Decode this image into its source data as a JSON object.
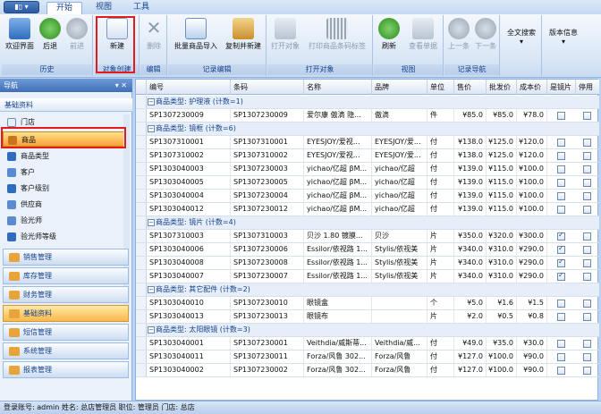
{
  "menu_label": "▮▯ ▾",
  "tabs": [
    "开始",
    "视图",
    "工具"
  ],
  "ribbon": {
    "groups": [
      "历史",
      "对象创建",
      "编辑",
      "记录编辑",
      "打开对象",
      "视图",
      "记录导航",
      "",
      ""
    ],
    "buttons": {
      "welcome": "欢迎界面",
      "back": "后退",
      "forward": "前进",
      "new": "新建",
      "delete": "删除",
      "batch_import": "批量商品导入",
      "copy_new": "复制并新建",
      "open_object": "打开对象",
      "print_barcode": "打印商品条码标签",
      "refresh": "刷新",
      "view_form": "查看单据",
      "prev": "上一条",
      "next": "下一条",
      "full_search": "全文搜索",
      "version_info": "版本信息"
    }
  },
  "nav": {
    "title": "导航",
    "pin": "▾ ✕",
    "category": "基础资料",
    "items": [
      "门店",
      "商品",
      "商品类型",
      "客户",
      "客户级别",
      "供应商",
      "验光师",
      "验光师等级"
    ],
    "categories": [
      "销售管理",
      "库存管理",
      "财务管理",
      "基础资料",
      "短信管理",
      "系统管理",
      "报表管理"
    ]
  },
  "grid": {
    "columns": [
      "编号",
      "条码",
      "名称",
      "品牌",
      "单位",
      "售价",
      "批发价",
      "成本价",
      "是镜片",
      "停用"
    ],
    "groups": [
      {
        "title": "商品类型: 护理液 (计数=1)",
        "rows": [
          {
            "id": "SP1307230009",
            "barcode": "SP1307230009",
            "name": "爱尔康 傲滴 隐...",
            "brand": "傲滴",
            "unit": "件",
            "price": "¥85.0",
            "wholesale": "¥85.0",
            "cost": "¥78.0",
            "lens": false
          }
        ]
      },
      {
        "title": "商品类型: 镜框 (计数=6)",
        "rows": [
          {
            "id": "SP1307310001",
            "barcode": "SP1307310001",
            "name": "EYESJOY/爱视...",
            "brand": "EYESJOY/爱...",
            "unit": "付",
            "price": "¥138.0",
            "wholesale": "¥125.0",
            "cost": "¥120.0",
            "lens": false
          },
          {
            "id": "SP1307310002",
            "barcode": "SP1307310002",
            "name": "EYESJOY/爱视...",
            "brand": "EYESJOY/爱...",
            "unit": "付",
            "price": "¥138.0",
            "wholesale": "¥125.0",
            "cost": "¥120.0",
            "lens": false
          },
          {
            "id": "SP1303040003",
            "barcode": "SP1307230003",
            "name": "yichao/亿超 βM...",
            "brand": "yichao/亿超",
            "unit": "付",
            "price": "¥139.0",
            "wholesale": "¥115.0",
            "cost": "¥100.0",
            "lens": false
          },
          {
            "id": "SP1303040005",
            "barcode": "SP1307230005",
            "name": "yichao/亿超 βM...",
            "brand": "yichao/亿超",
            "unit": "付",
            "price": "¥139.0",
            "wholesale": "¥115.0",
            "cost": "¥100.0",
            "lens": false
          },
          {
            "id": "SP1303040004",
            "barcode": "SP1307230004",
            "name": "yichao/亿超 βM...",
            "brand": "yichao/亿超",
            "unit": "付",
            "price": "¥139.0",
            "wholesale": "¥115.0",
            "cost": "¥100.0",
            "lens": false
          },
          {
            "id": "SP1303040012",
            "barcode": "SP1307230012",
            "name": "yichao/亿超 βM...",
            "brand": "yichao/亿超",
            "unit": "付",
            "price": "¥139.0",
            "wholesale": "¥115.0",
            "cost": "¥100.0",
            "lens": false
          }
        ]
      },
      {
        "title": "商品类型: 镜片 (计数=4)",
        "rows": [
          {
            "id": "SP1307310003",
            "barcode": "SP1307310003",
            "name": "贝沙 1.80 镀膜...",
            "brand": "贝沙",
            "unit": "片",
            "price": "¥350.0",
            "wholesale": "¥320.0",
            "cost": "¥300.0",
            "lens": true
          },
          {
            "id": "SP1303040006",
            "barcode": "SP1307230006",
            "name": "Essilor/依视路 1...",
            "brand": "Stylis/依视美",
            "unit": "片",
            "price": "¥340.0",
            "wholesale": "¥310.0",
            "cost": "¥290.0",
            "lens": true
          },
          {
            "id": "SP1303040008",
            "barcode": "SP1307230008",
            "name": "Essilor/依视路 1...",
            "brand": "Stylis/依视美",
            "unit": "片",
            "price": "¥340.0",
            "wholesale": "¥310.0",
            "cost": "¥290.0",
            "lens": true
          },
          {
            "id": "SP1303040007",
            "barcode": "SP1307230007",
            "name": "Essilor/依视路 1...",
            "brand": "Stylis/依视美",
            "unit": "片",
            "price": "¥340.0",
            "wholesale": "¥310.0",
            "cost": "¥290.0",
            "lens": true
          }
        ]
      },
      {
        "title": "商品类型: 其它配件 (计数=2)",
        "rows": [
          {
            "id": "SP1303040010",
            "barcode": "SP1307230010",
            "name": "眼镜盒",
            "brand": "",
            "unit": "个",
            "price": "¥5.0",
            "wholesale": "¥1.6",
            "cost": "¥1.5",
            "lens": false
          },
          {
            "id": "SP1303040013",
            "barcode": "SP1307230013",
            "name": "眼镜布",
            "brand": "",
            "unit": "片",
            "price": "¥2.0",
            "wholesale": "¥0.5",
            "cost": "¥0.8",
            "lens": false
          }
        ]
      },
      {
        "title": "商品类型: 太阳眼镜 (计数=3)",
        "rows": [
          {
            "id": "SP1303040001",
            "barcode": "SP1307230001",
            "name": "Veithdia/威斯蒂...",
            "brand": "Veithdia/威...",
            "unit": "付",
            "price": "¥49.0",
            "wholesale": "¥35.0",
            "cost": "¥30.0",
            "lens": false
          },
          {
            "id": "SP1303040011",
            "barcode": "SP1307230011",
            "name": "Forza/风鲁 302...",
            "brand": "Forza/风鲁",
            "unit": "付",
            "price": "¥127.0",
            "wholesale": "¥100.0",
            "cost": "¥90.0",
            "lens": false
          },
          {
            "id": "SP1303040002",
            "barcode": "SP1307230002",
            "name": "Forza/风鲁 302...",
            "brand": "Forza/风鲁",
            "unit": "付",
            "price": "¥127.0",
            "wholesale": "¥100.0",
            "cost": "¥90.0",
            "lens": false
          }
        ]
      }
    ]
  },
  "status": "登录账号: admin  姓名: 总店管理员  职位: 管理员  门店: 总店",
  "colors": {
    "accent": "#15428b",
    "highlight": "#e31b1b",
    "selected": "#f9a13a"
  }
}
